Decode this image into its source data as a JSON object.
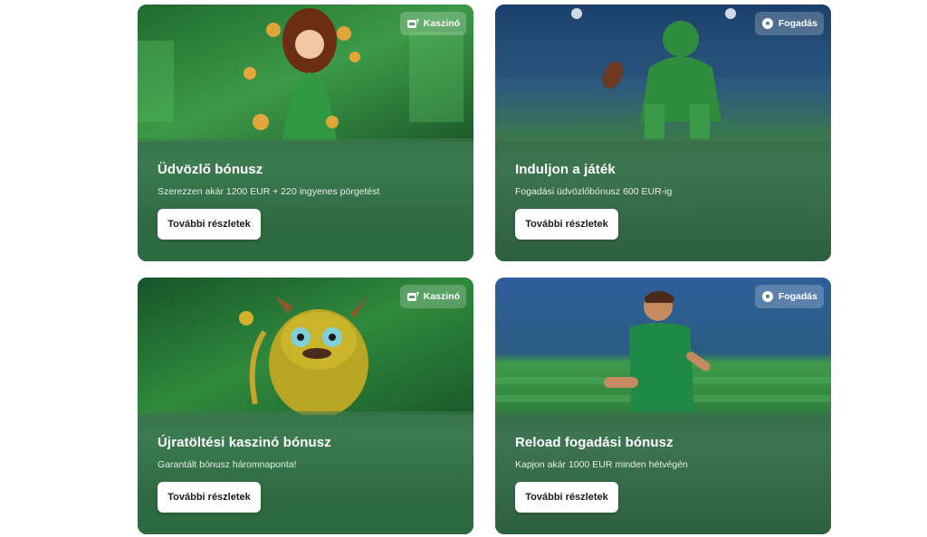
{
  "cards": [
    {
      "badge": {
        "label": "Kaszinó",
        "icon": "slot-machine-icon"
      },
      "title": "Üdvözlő bónusz",
      "subtitle": "Szerezzen akár 1200 EUR + 220 ingyenes pörgetést",
      "button": "További részletek"
    },
    {
      "badge": {
        "label": "Fogadás",
        "icon": "soccer-ball-icon"
      },
      "title": "Induljon a játék",
      "subtitle": "Fogadási üdvözlőbónusz 600 EUR-ig",
      "button": "További részletek"
    },
    {
      "badge": {
        "label": "Kaszinó",
        "icon": "slot-machine-icon"
      },
      "title": "Újratöltési kaszinó bónusz",
      "subtitle": "Garantált bónusz háromnaponta!",
      "button": "További részletek"
    },
    {
      "badge": {
        "label": "Fogadás",
        "icon": "soccer-ball-icon"
      },
      "title": "Reload fogadási bónusz",
      "subtitle": "Kapjon akár 1000 EUR minden hétvégén",
      "button": "További részletek"
    }
  ],
  "colors": {
    "card_green": "#2e6e44",
    "button_bg": "#ffffff",
    "page_bg": "#ffffff"
  }
}
